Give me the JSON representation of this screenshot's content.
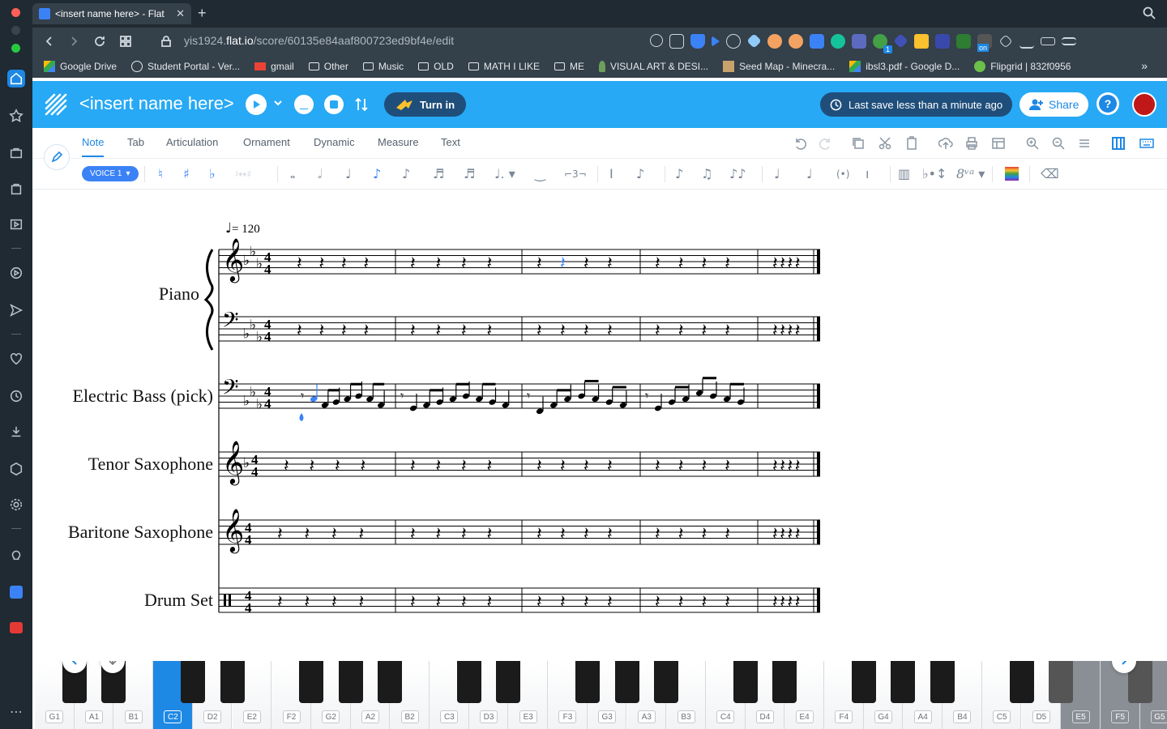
{
  "browser": {
    "tab_title": "<insert name here> - Flat",
    "url_host": "yis1924.",
    "url_domain": "flat.io",
    "url_path": "/score/60135e84aaf800723ed9bf4e/edit",
    "bookmarks": [
      "Google Drive",
      "Student Portal - Ver...",
      "gmail",
      "Other",
      "Music",
      "OLD",
      "MATH I LIKE",
      "ME",
      "VISUAL ART & DESI...",
      "Seed Map - Minecra...",
      "ibsl3.pdf - Google D...",
      "Flipgrid | 832f0956"
    ],
    "ext_badge": "1",
    "ext_on_label": "on"
  },
  "header": {
    "title": "<insert name here>",
    "turn_in": "Turn in",
    "last_save": "Last save less than a minute ago",
    "share": "Share",
    "help": "?"
  },
  "tool_tabs": [
    "Note",
    "Tab",
    "Articulation",
    "Ornament",
    "Dynamic",
    "Measure",
    "Text"
  ],
  "voice_label": "VOICE 1",
  "score": {
    "tempo": "= 120",
    "instruments": [
      "Piano",
      "Electric Bass (pick)",
      "Tenor Saxophone",
      "Baritone Saxophone",
      "Drum Set"
    ],
    "time_signature": "4/4"
  },
  "keyboard": {
    "keys": [
      "G1",
      "A1",
      "B1",
      "C2",
      "D2",
      "E2",
      "F2",
      "G2",
      "A2",
      "B2",
      "C3",
      "D3",
      "E3",
      "F3",
      "G3",
      "A3",
      "B3",
      "C4",
      "D4",
      "E4",
      "F4",
      "G4",
      "A4",
      "B4",
      "C5",
      "D5",
      "E5",
      "F5",
      "G5"
    ],
    "selected": "C2"
  },
  "colors": {
    "accent": "#27a9f5",
    "primary": "#1e88e5",
    "dark": "#1f4e7a"
  }
}
